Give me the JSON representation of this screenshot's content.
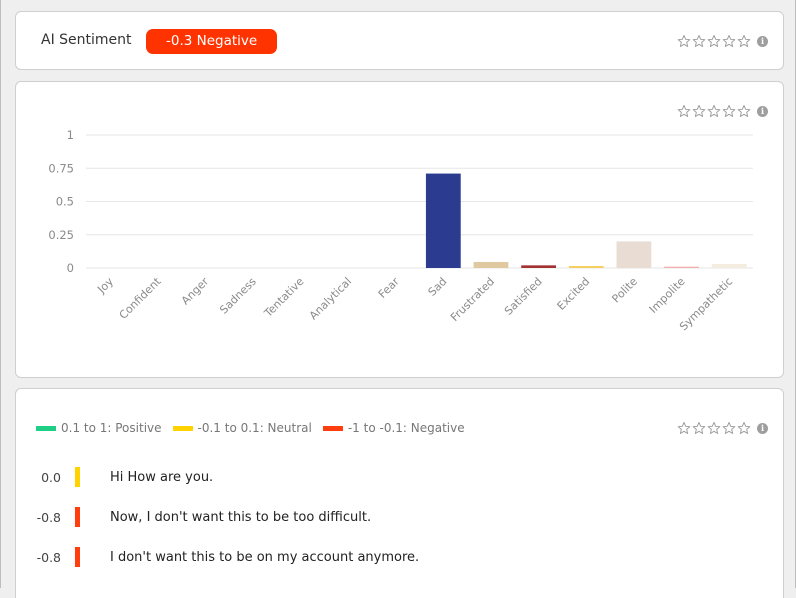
{
  "sentiment": {
    "label": "AI Sentiment",
    "badge_text": "-0.3 Negative",
    "badge_color": "#ff3300",
    "score": -0.3,
    "rating_stars": 5,
    "rating_value": 0
  },
  "chart": {
    "rating_stars": 5,
    "rating_value": 0
  },
  "chart_data": {
    "type": "bar",
    "title": "",
    "xlabel": "",
    "ylabel": "",
    "ylim": [
      0,
      1
    ],
    "yticks": [
      "0",
      "0.25",
      "0.5",
      "0.75",
      "1"
    ],
    "grid": true,
    "categories": [
      "Joy",
      "Confident",
      "Anger",
      "Sadness",
      "Tentative",
      "Analytical",
      "Fear",
      "Sad",
      "Frustrated",
      "Satisfied",
      "Excited",
      "Polite",
      "Impolite",
      "Sympathetic"
    ],
    "values": [
      0,
      0,
      0,
      0,
      0,
      0,
      0,
      0.71,
      0.045,
      0.02,
      0.015,
      0.2,
      0.01,
      0.03
    ],
    "colors": [
      "#2b3b8f",
      "#2b3b8f",
      "#2b3b8f",
      "#2b3b8f",
      "#2b3b8f",
      "#2b3b8f",
      "#2b3b8f",
      "#2b3b8f",
      "#e0c8a0",
      "#a33333",
      "#f5d060",
      "#e9ddd3",
      "#f5b0b0",
      "#f5ece0"
    ]
  },
  "lines_panel": {
    "rating_stars": 5,
    "rating_value": 0,
    "legend": [
      {
        "label": "0.1 to 1: Positive",
        "color": "#1fcf86"
      },
      {
        "label": "-0.1 to 0.1: Neutral",
        "color": "#ffd200"
      },
      {
        "label": "-1 to -0.1: Negative",
        "color": "#ff3d0f"
      }
    ],
    "lines": [
      {
        "score": "0.0",
        "text": "Hi How are you.",
        "color": "#ffd200"
      },
      {
        "score": "-0.8",
        "text": "Now, I don't want this to be too difficult.",
        "color": "#ff3d0f"
      },
      {
        "score": "-0.8",
        "text": "I don't want this to be on my account anymore.",
        "color": "#ff3d0f"
      }
    ]
  },
  "icons": {
    "star": "star-outline-icon",
    "info": "info-icon"
  },
  "info_glyph": "i"
}
